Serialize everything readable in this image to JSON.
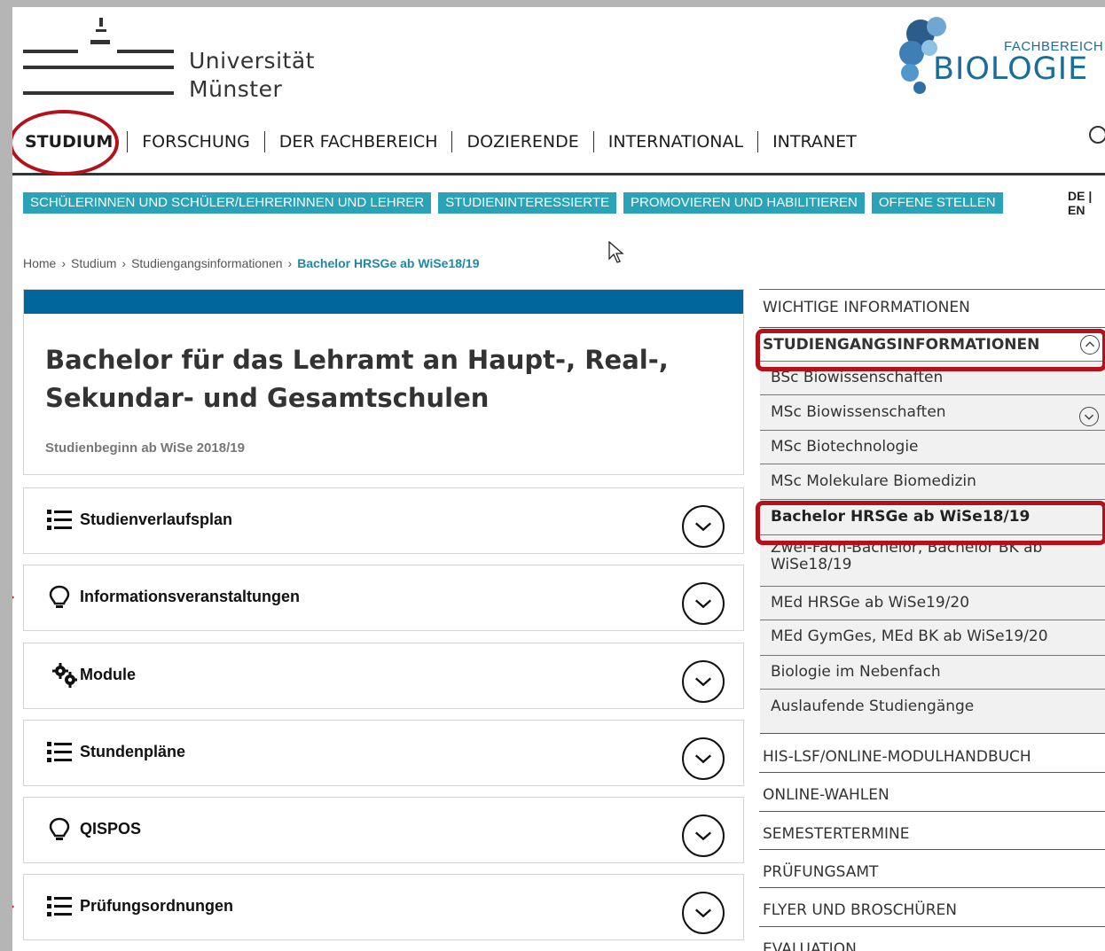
{
  "header": {
    "uni_line1": "Universität",
    "uni_line2": "Münster",
    "faculty_kicker": "FACHBEREICH",
    "faculty_name": "BIOLOGIE"
  },
  "main_nav": [
    "STUDIUM",
    "FORSCHUNG",
    "DER FACHBEREICH",
    "DOZIERENDE",
    "INTERNATIONAL",
    "INTRANET"
  ],
  "sub_nav": [
    "SCHÜLERINNEN UND SCHÜLER/LEHRERINNEN UND LEHRER",
    "STUDIENINTERESSIERTE",
    "PROMOVIEREN UND HABILITIEREN",
    "OFFENE STELLEN"
  ],
  "language": "DE | EN",
  "breadcrumb": {
    "items": [
      "Home",
      "Studium",
      "Studiengangsinformationen"
    ],
    "separator": "›",
    "current": "Bachelor HRSGe ab WiSe18/19"
  },
  "content": {
    "title": "Bachelor für das Lehramt an Haupt-, Real-, Sekundar- und Gesamtschulen",
    "subtitle": "Studienbeginn ab WiSe 2018/19",
    "sections": [
      {
        "label": "Studienverlaufsplan",
        "icon": "list-icon"
      },
      {
        "label": "Informationsveranstaltungen",
        "icon": "lightbulb-icon"
      },
      {
        "label": "Module",
        "icon": "gears-icon"
      },
      {
        "label": "Stundenpläne",
        "icon": "list-icon"
      },
      {
        "label": "QISPOS",
        "icon": "lightbulb-icon"
      },
      {
        "label": "Prüfungsordnungen",
        "icon": "list-icon"
      }
    ]
  },
  "sidebar": {
    "items": [
      "WICHTIGE INFORMATIONEN",
      "STUDIENGANGSINFORMATIONEN",
      "BSc Biowissenschaften",
      "MSc Biowissenschaften",
      "MSc Biotechnologie",
      "MSc Molekulare Biomedizin",
      "Bachelor HRSGe ab WiSe18/19",
      "Zwei-Fach-Bachelor, Bachelor BK ab WiSe18/19",
      "MEd HRSGe ab WiSe19/20",
      "MEd GymGes, MEd BK ab WiSe19/20",
      "Biologie im Nebenfach",
      "Auslaufende Studiengänge",
      "HIS-LSF/ONLINE-MODULHANDBUCH",
      "ONLINE-WAHLEN",
      "SEMESTERTERMINE",
      "PRÜFUNGSAMT",
      "FLYER UND BROSCHÜREN",
      "EVALUATION"
    ]
  },
  "colors": {
    "accent_teal": "#2aa2b7",
    "header_blue": "#00669c",
    "annotation_red": "#b3121b",
    "biology_blue": "#1a6d9a"
  }
}
